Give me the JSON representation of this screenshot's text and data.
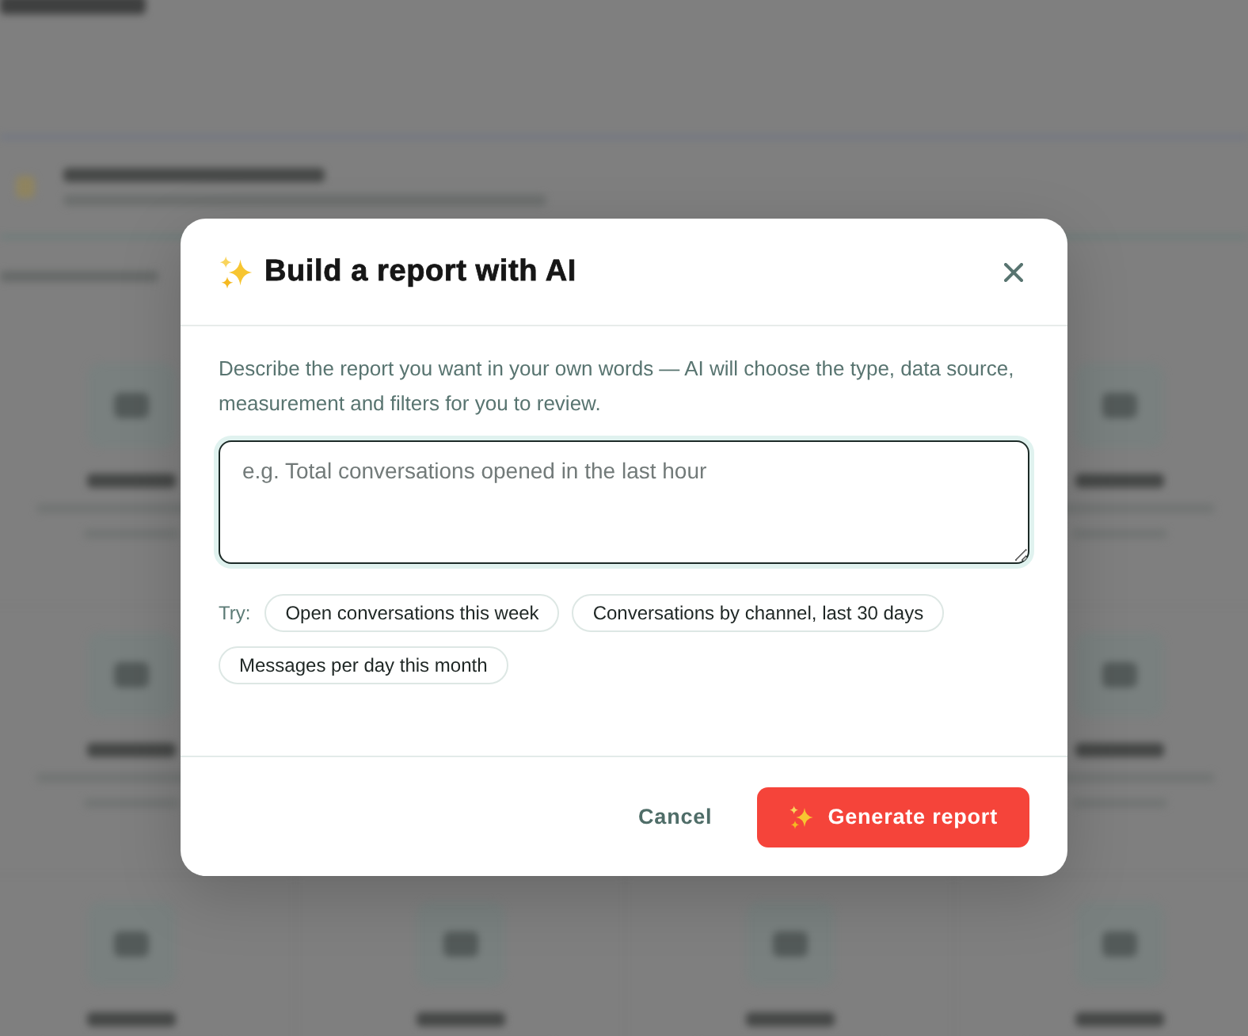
{
  "dialog": {
    "title": "Build a report with AI",
    "description": "Describe the report you want in your own words — AI will choose the type, data source, measurement and filters for you to review.",
    "prompt_field": {
      "placeholder": "e.g. Total conversations opened in the last hour",
      "focused": true
    },
    "suggestions": {
      "label": "Try:",
      "chips": [
        "Open conversations this week",
        "Conversations by channel, last 30 days",
        "Messages per day this month"
      ]
    },
    "buttons": [
      {
        "label": "Cancel",
        "kind": "secondary"
      },
      {
        "label": "Generate report",
        "kind": "primary"
      }
    ]
  }
}
